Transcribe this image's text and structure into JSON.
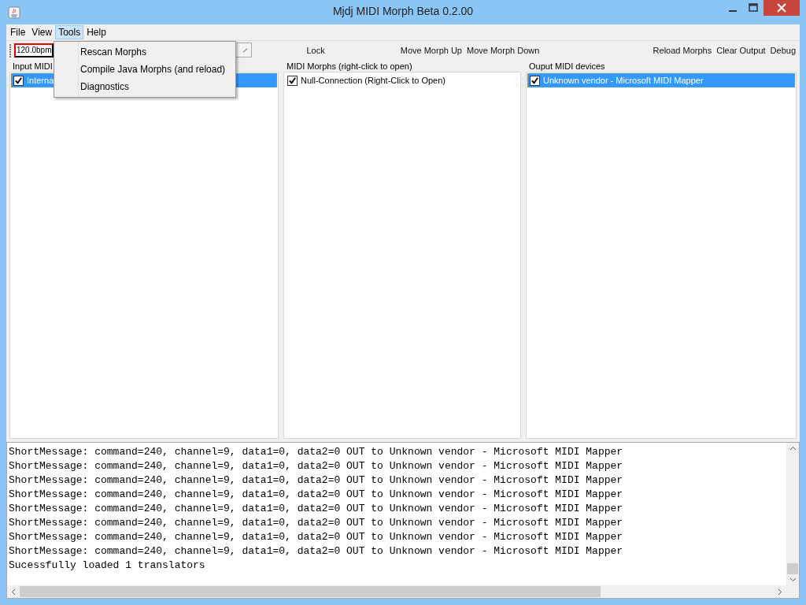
{
  "window": {
    "title": "Mjdj MIDI Morph Beta 0.2.00"
  },
  "menu": [
    {
      "label": "File",
      "selected": false
    },
    {
      "label": "View",
      "selected": false
    },
    {
      "label": "Tools",
      "selected": true
    },
    {
      "label": "Help",
      "selected": false
    }
  ],
  "open_menu": {
    "items": [
      "Rescan Morphs",
      "Compile Java Morphs (and reload)",
      "Diagnostics"
    ]
  },
  "toolbar": {
    "tempo_field": "120.0bpm",
    "left_buttons": [
      "Lock",
      "Move Morph Up",
      "Move Morph Down"
    ],
    "right_buttons": [
      "Reload Morphs",
      "Clear Output",
      "Debug"
    ]
  },
  "panels": [
    {
      "title": "Input MIDI",
      "items": [
        {
          "label": "Interna",
          "checked": true,
          "selected": true
        }
      ]
    },
    {
      "title": "MIDI Morphs (right-click to open)",
      "items": [
        {
          "label": "Null-Connection (Right-Click to Open)",
          "checked": true,
          "selected": false
        }
      ]
    },
    {
      "title": "Ouput MIDI devices",
      "items": [
        {
          "label": "Unknown vendor - Microsoft MIDI Mapper",
          "checked": true,
          "selected": true
        }
      ]
    }
  ],
  "output": [
    "ShortMessage: command=240, channel=9, data1=0, data2=0 OUT to Unknown vendor - Microsoft MIDI Mapper",
    "ShortMessage: command=240, channel=9, data1=0, data2=0 OUT to Unknown vendor - Microsoft MIDI Mapper",
    "ShortMessage: command=240, channel=9, data1=0, data2=0 OUT to Unknown vendor - Microsoft MIDI Mapper",
    "ShortMessage: command=240, channel=9, data1=0, data2=0 OUT to Unknown vendor - Microsoft MIDI Mapper",
    "ShortMessage: command=240, channel=9, data1=0, data2=0 OUT to Unknown vendor - Microsoft MIDI Mapper",
    "ShortMessage: command=240, channel=9, data1=0, data2=0 OUT to Unknown vendor - Microsoft MIDI Mapper",
    "ShortMessage: command=240, channel=9, data1=0, data2=0 OUT to Unknown vendor - Microsoft MIDI Mapper",
    "ShortMessage: command=240, channel=9, data1=0, data2=0 OUT to Unknown vendor - Microsoft MIDI Mapper",
    "Sucessfully loaded 1 translators"
  ]
}
